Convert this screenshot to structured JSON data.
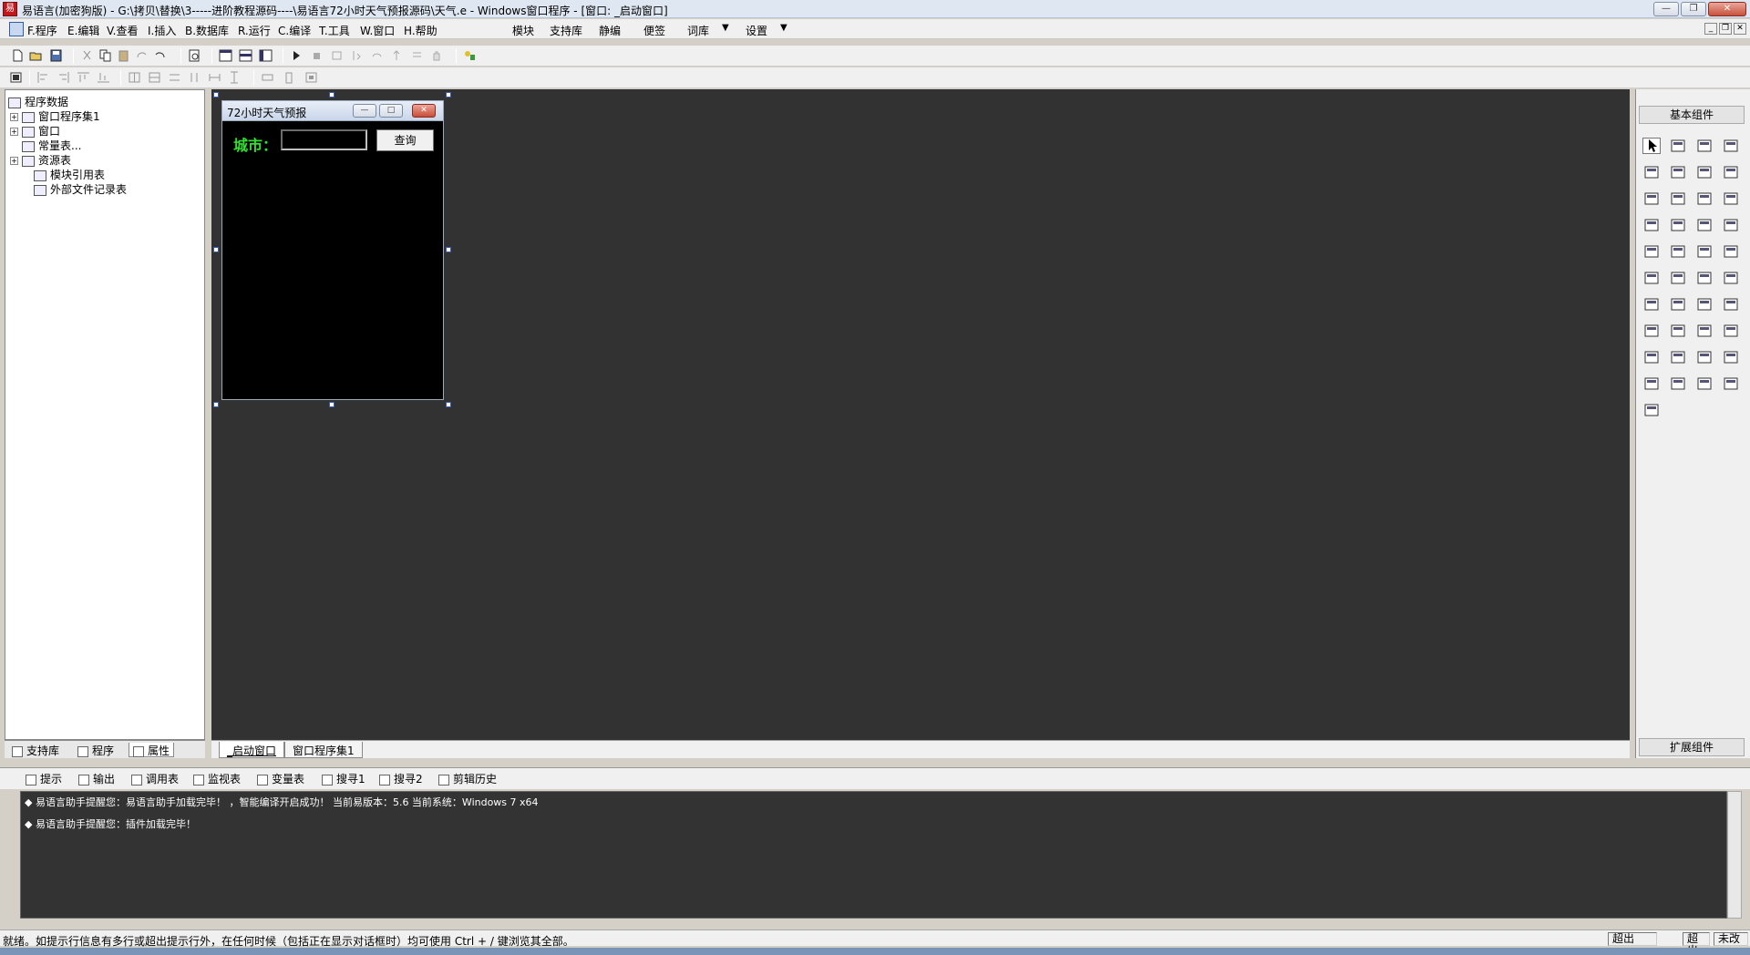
{
  "window": {
    "title": "易语言(加密狗版) - G:\\拷贝\\替换\\3-----进阶教程源码----\\易语言72小时天气预报源码\\天气.e - Windows窗口程序 - [窗口: _启动窗口]",
    "app_icon": "易",
    "min": "—",
    "max": "❐",
    "close": "✕"
  },
  "menu": {
    "items": [
      "F.程序",
      "E.编辑",
      "V.查看",
      "I.插入",
      "B.数据库",
      "R.运行",
      "C.编译",
      "T.工具",
      "W.窗口",
      "H.帮助",
      "模块",
      "支持库",
      "静编",
      "便签",
      "词库",
      "设置"
    ],
    "dropdown_arrow": "▼"
  },
  "left_panel": {
    "tree": [
      {
        "label": "程序数据",
        "expander": ""
      },
      {
        "label": "窗口程序集1",
        "expander": "+"
      },
      {
        "label": "窗口",
        "expander": "+"
      },
      {
        "label": "常量表...",
        "expander": ""
      },
      {
        "label": "资源表",
        "expander": "+"
      },
      {
        "label": "模块引用表",
        "expander": ""
      },
      {
        "label": "外部文件记录表",
        "expander": ""
      }
    ],
    "tabs": [
      "支持库",
      "程序",
      "属性"
    ]
  },
  "form": {
    "caption": "72小时天气预报",
    "city_label": "城市：",
    "query_button": "查询",
    "min": "—",
    "max": "□",
    "close": "✕"
  },
  "designer_tabs": [
    "_启动窗口",
    "窗口程序集1"
  ],
  "right_panel": {
    "header": "基本组件",
    "footer": "扩展组件",
    "components": [
      "pointer-icon",
      "label-icon",
      "image-box-icon",
      "shape-icon",
      "edit-box-icon",
      "blank-icon",
      "text-char-icon",
      "line-icon",
      "checkbox-icon",
      "radio-icon",
      "listbox-icon",
      "combo-icon",
      "grid-icon",
      "scroll-icon",
      "vscroll-icon",
      "progress-icon",
      "slider-icon",
      "tab-icon",
      "frame-icon",
      "picture-icon",
      "calendar-icon",
      "drive-icon",
      "folder-icon",
      "file-icon",
      "color-icon",
      "printer-icon",
      "hotkey-icon",
      "tray-icon",
      "timer-icon",
      "mci-icon",
      "data-source-icon",
      "data-provider-icon",
      "client-icon",
      "server-icon",
      "serial-icon",
      "db-icon",
      "table-icon",
      "chart-icon",
      "odbc-icon",
      "odbc2-icon",
      "odbc3-icon"
    ]
  },
  "bottom_tabs": [
    "提示",
    "输出",
    "调用表",
    "监视表",
    "变量表",
    "搜寻1",
    "搜寻2",
    "剪辑历史"
  ],
  "output_lines": [
    "◆ 易语言助手提醒您：易语言助手加载完毕！ ，智能编译开启成功！ 当前易版本：5.6  当前系统：Windows 7 x64",
    "◆ 易语言助手提醒您：插件加载完毕！"
  ],
  "status": {
    "text": "就绪。如提示行信息有多行或超出提示行外，在任何时候（包括正在显示对话框时）均可使用 Ctrl + / 键浏览其全部。",
    "pane1": "超出",
    "pane2": "超出",
    "pane3": "未改"
  }
}
